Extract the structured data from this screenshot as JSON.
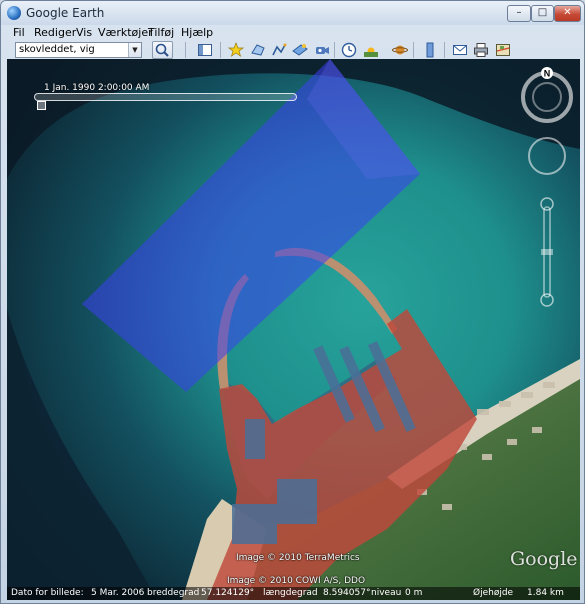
{
  "window": {
    "title": "Google Earth",
    "min": "–",
    "max": "□",
    "close": "✕"
  },
  "menu": [
    "Fil",
    "Rediger",
    "Vis",
    "Værktøjer",
    "Tilføj",
    "Hjælp"
  ],
  "search": {
    "value": "skovleddet, vig"
  },
  "toolbar_icons": [
    "sidebar-toggle-icon",
    "placemark-icon",
    "polygon-icon",
    "path-icon",
    "image-overlay-icon",
    "record-tour-icon",
    "historical-imagery-icon",
    "sunlight-icon",
    "planets-icon",
    "ruler-icon",
    "email-icon",
    "print-icon",
    "maps-icon"
  ],
  "time_slider": {
    "label": "1 Jan. 1990   2:00:00 AM"
  },
  "navigation": {
    "north": "N"
  },
  "credits": {
    "image1": "Image © 2010 TerraMetrics",
    "image2": "Image © 2010 COWI A/S, DDO",
    "logo": "Google"
  },
  "status": {
    "date_label": "Dato for billede:",
    "date_value": "5 Mar. 2006",
    "lat_label": "breddegrad",
    "lat_value": "57.124129°",
    "lon_label": "længdegrad",
    "lon_value": "8.594057°",
    "elev_label": "niveau",
    "elev_value": "0 m",
    "eye_label": "Øjehøjde",
    "eye_value": "1.84 km"
  },
  "colors": {
    "overlay_blue": "#3d3ff0",
    "harbor_red": "#c0483a",
    "sea_dark": "#0d2232",
    "sea_teal": "#1a8c8a"
  }
}
